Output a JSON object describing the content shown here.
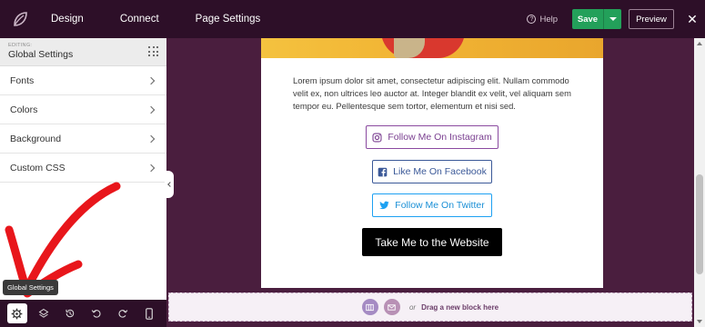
{
  "topbar": {
    "logo_icon": "seedprod-leaf-logo",
    "nav": [
      {
        "label": "Design"
      },
      {
        "label": "Connect"
      },
      {
        "label": "Page Settings"
      }
    ],
    "help_label": "Help",
    "save_label": "Save",
    "preview_label": "Preview",
    "close_label": "✕"
  },
  "sidebar": {
    "editing_label": "EDITING:",
    "title": "Global Settings",
    "items": [
      {
        "label": "Fonts"
      },
      {
        "label": "Colors"
      },
      {
        "label": "Background"
      },
      {
        "label": "Custom CSS"
      }
    ]
  },
  "tooltip": "Global Settings",
  "bottombar": {
    "tools": [
      "gear-icon",
      "layers-icon",
      "history-icon",
      "undo-icon",
      "redo-icon",
      "mobile-icon"
    ]
  },
  "canvas": {
    "body_text": "Lorem ipsum dolor sit amet, consectetur adipiscing elit. Nullam commodo velit ex, non ultrices leo auctor at. Integer blandit ex velit, vel aliquam sem tempor eu. Pellentesque sem tortor, elementum et nisi sed.",
    "buttons": {
      "instagram": "Follow Me On Instagram",
      "facebook": "Like Me On Facebook",
      "twitter": "Follow Me On Twitter",
      "website": "Take Me to the Website"
    },
    "dropzone": {
      "or": "or",
      "text": "Drag a new block here"
    }
  },
  "colors": {
    "topbar_bg": "#2d0f28",
    "canvas_bg": "#4a1e3e",
    "save_green": "#23a05a",
    "instagram": "#8a4aa0",
    "facebook": "#3b5998",
    "twitter": "#1da1f2",
    "annotation_arrow": "#e8161b"
  }
}
